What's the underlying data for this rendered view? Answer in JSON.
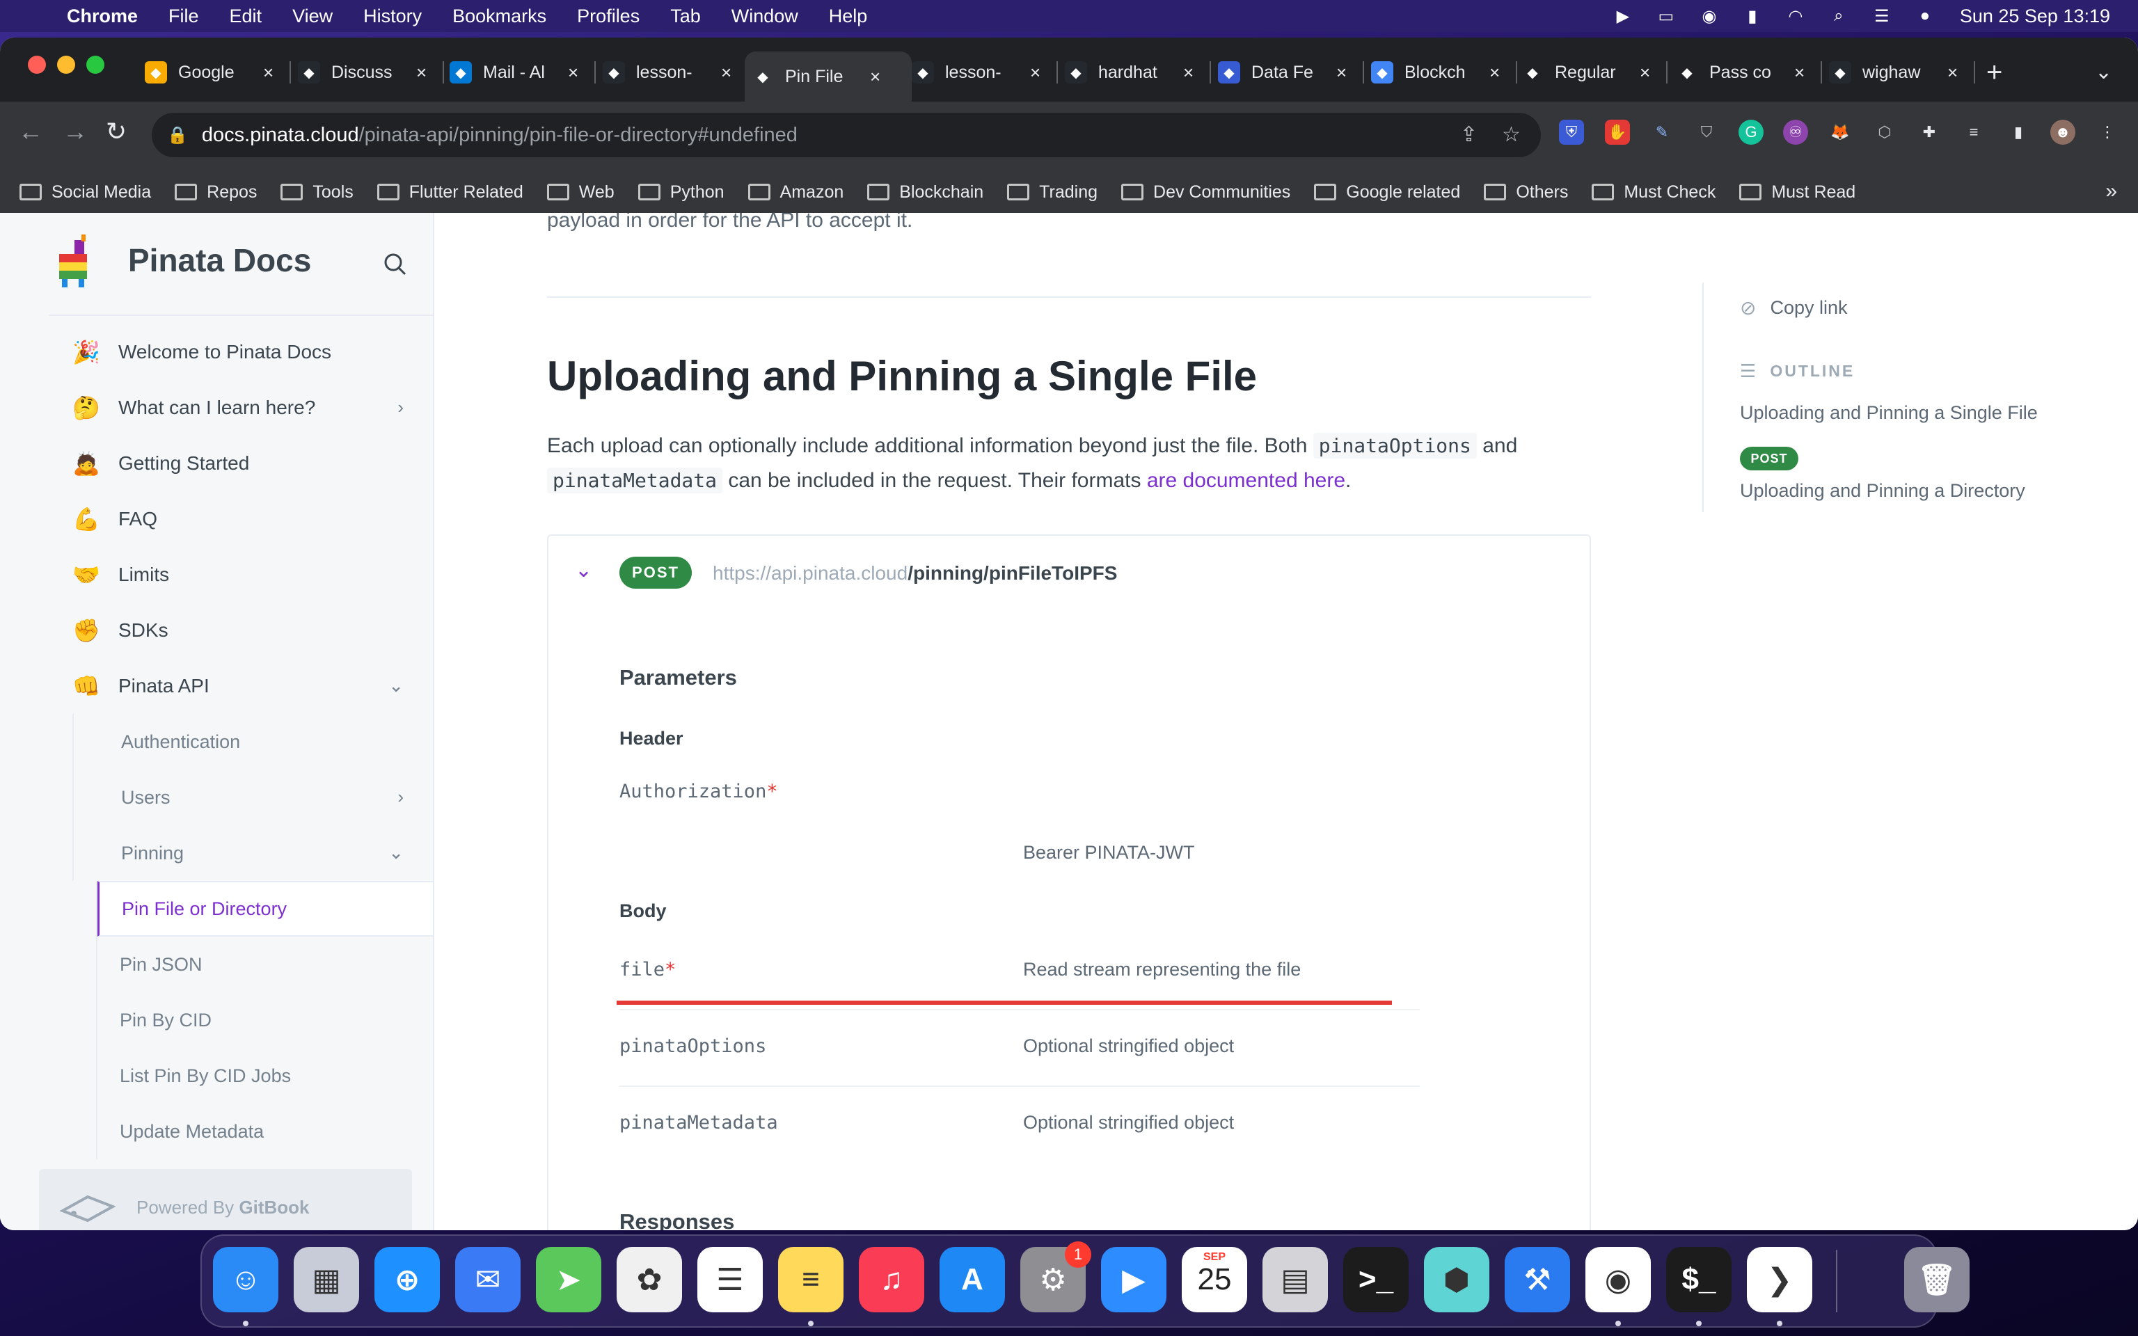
{
  "menubar": {
    "app": "Chrome",
    "items": [
      "File",
      "Edit",
      "View",
      "History",
      "Bookmarks",
      "Profiles",
      "Tab",
      "Window",
      "Help"
    ],
    "clock": "Sun 25 Sep  13:19"
  },
  "tabs": [
    {
      "title": "Google",
      "icon": "google-icon",
      "color": "#f9ab00"
    },
    {
      "title": "Discuss",
      "icon": "github-icon",
      "color": "#24292f"
    },
    {
      "title": "Mail - Al",
      "icon": "outlook-icon",
      "color": "#0078d4"
    },
    {
      "title": "lesson-",
      "icon": "github-icon",
      "color": "#24292f"
    },
    {
      "title": "Pin File",
      "icon": "pinata-icon",
      "color": "#35363a"
    },
    {
      "title": "lesson-",
      "icon": "github-icon",
      "color": "#24292f"
    },
    {
      "title": "hardhat",
      "icon": "github-icon",
      "color": "#24292f"
    },
    {
      "title": "Data Fe",
      "icon": "chainlink-icon",
      "color": "#375bd2"
    },
    {
      "title": "Blockch",
      "icon": "docs-icon",
      "color": "#4285f4"
    },
    {
      "title": "Regular",
      "icon": "regex-icon",
      "color": "#202124"
    },
    {
      "title": "Pass co",
      "icon": "solidity-icon",
      "color": "#202124"
    },
    {
      "title": "wighaw",
      "icon": "github-icon",
      "color": "#24292f"
    }
  ],
  "address": {
    "host": "docs.pinata.cloud",
    "path": "/pinata-api/pinning/pin-file-or-directory#undefined"
  },
  "bookmarks": [
    "Social Media",
    "Repos",
    "Tools",
    "Flutter Related",
    "Web",
    "Python",
    "Amazon",
    "Blockchain",
    "Trading",
    "Dev Communities",
    "Google related",
    "Others",
    "Must Check",
    "Must Read"
  ],
  "sidebar": {
    "brand": "Pinata Docs",
    "items": [
      {
        "emoji": "🎉",
        "label": "Welcome to Pinata Docs",
        "chevron": ""
      },
      {
        "emoji": "🤔",
        "label": "What can I learn here?",
        "chevron": "›"
      },
      {
        "emoji": "🙇",
        "label": "Getting Started",
        "chevron": ""
      },
      {
        "emoji": "💪",
        "label": "FAQ",
        "chevron": ""
      },
      {
        "emoji": "🤝",
        "label": "Limits",
        "chevron": ""
      },
      {
        "emoji": "✊",
        "label": "SDKs",
        "chevron": ""
      },
      {
        "emoji": "👊",
        "label": "Pinata API",
        "chevron": "⌄"
      }
    ],
    "sub": [
      {
        "label": "Authentication",
        "chevron": ""
      },
      {
        "label": "Users",
        "chevron": "›"
      },
      {
        "label": "Pinning",
        "chevron": "⌄"
      }
    ],
    "pinning": [
      "Pin File or Directory",
      "Pin JSON",
      "Pin By CID",
      "List Pin By CID Jobs",
      "Update Metadata"
    ],
    "powered_prefix": "Powered By ",
    "powered_brand": "GitBook"
  },
  "content": {
    "lead": "payload in order for the API to accept it.",
    "title": "Uploading and Pinning a Single File",
    "p_before1": "Each upload can optionally include additional information beyond just the file. Both ",
    "code1": "pinataOptions",
    "p_mid": " and ",
    "code2": "pinataMetadata",
    "p_mid2": " can be included in the request. Their formats ",
    "link": "are documented here",
    "p_end": ".",
    "method": "POST",
    "base_url": "https://api.pinata.cloud",
    "endpoint": "/pinning/pinFileToIPFS",
    "parameters": "Parameters",
    "header": "Header",
    "auth_name": "Authorization",
    "auth_req": "*",
    "auth_desc": "Bearer PINATA-JWT",
    "body": "Body",
    "file_name": "file",
    "file_req": "*",
    "file_desc": "Read stream representing the file",
    "opt_name": "pinataOptions",
    "opt_desc": "Optional stringified object",
    "meta_name": "pinataMetadata",
    "meta_desc": "Optional stringified object",
    "responses": "Responses"
  },
  "outline": {
    "copy": "Copy link",
    "head": "OUTLINE",
    "item1": "Uploading and Pinning a Single File",
    "badge": "POST",
    "item2": "Uploading and Pinning a Directory"
  },
  "dock": [
    {
      "name": "finder",
      "color": "#2a8af6",
      "glyph": "☺"
    },
    {
      "name": "launchpad",
      "color": "#c8ccd8",
      "glyph": "▦"
    },
    {
      "name": "safari",
      "color": "#1e90ff",
      "glyph": "⊕"
    },
    {
      "name": "mail",
      "color": "#3a7bf5",
      "glyph": "✉"
    },
    {
      "name": "maps",
      "color": "#5ac85a",
      "glyph": "➤"
    },
    {
      "name": "photos",
      "color": "#f0f0f0",
      "glyph": "✿"
    },
    {
      "name": "reminders",
      "color": "#ffffff",
      "glyph": "☰"
    },
    {
      "name": "notes",
      "color": "#ffd95a",
      "glyph": "≡"
    },
    {
      "name": "music",
      "color": "#fa3c55",
      "glyph": "♫"
    },
    {
      "name": "app-store",
      "color": "#1e88f5",
      "glyph": "A"
    },
    {
      "name": "system-preferences",
      "color": "#8e8e93",
      "glyph": "⚙"
    },
    {
      "name": "zoom",
      "color": "#2d8cff",
      "glyph": "▶"
    },
    {
      "name": "calendar",
      "color": "#ffffff",
      "glyph": "25"
    },
    {
      "name": "calculator",
      "color": "#d4d4d8",
      "glyph": "▤"
    },
    {
      "name": "terminal",
      "color": "#1c1c1c",
      "glyph": ">_"
    },
    {
      "name": "box-app",
      "color": "#5fd4d4",
      "glyph": "⬢"
    },
    {
      "name": "xcode",
      "color": "#2a7bf0",
      "glyph": "⚒"
    },
    {
      "name": "chrome",
      "color": "#ffffff",
      "glyph": "◉"
    },
    {
      "name": "iterm",
      "color": "#1c1c1c",
      "glyph": "$_"
    },
    {
      "name": "vscode",
      "color": "#ffffff",
      "glyph": "❯"
    },
    {
      "name": "trash",
      "color": "#8a8a9a",
      "glyph": "🗑"
    }
  ],
  "dock_badge": "1",
  "calendar_month": "SEP"
}
